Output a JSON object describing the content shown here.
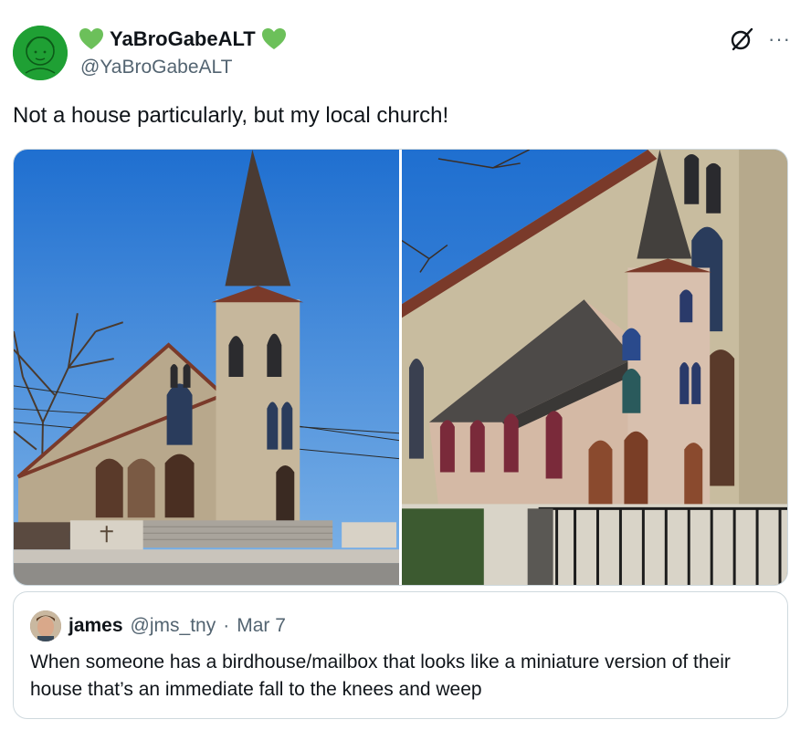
{
  "author": {
    "display_name": "YaBroGabeALT",
    "handle": "@YaBroGabeALT",
    "avatar_color": "#1fa034",
    "heart_color": "#6cc05a"
  },
  "icons": {
    "grok": "grok-icon",
    "more": "more-icon",
    "more_glyph": "···"
  },
  "tweet": {
    "text": "Not a house particularly, but my local church!"
  },
  "media": {
    "photos": [
      "church-photo",
      "birdhouse-church-photo"
    ]
  },
  "quote": {
    "name": "james",
    "handle": "@jms_tny",
    "separator": "·",
    "date": "Mar 7",
    "text": "When someone has a birdhouse/mailbox that looks like a miniature version of their house that’s an immediate fall to the knees and weep"
  },
  "colors": {
    "text_primary": "#0f1419",
    "text_secondary": "#536471",
    "border": "#cfd9de"
  }
}
